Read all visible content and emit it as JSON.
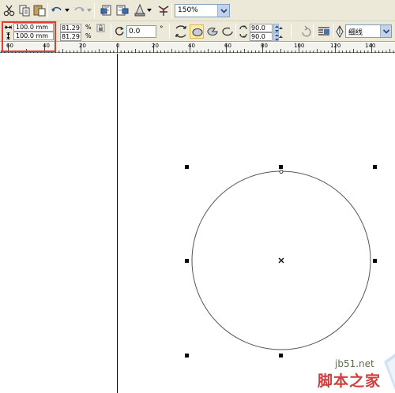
{
  "toolbar": {
    "zoom_value": "150%",
    "icons": [
      "scissors-icon",
      "copy-icon",
      "paste-icon",
      "undo-icon",
      "redo-icon",
      "import-icon",
      "export-icon",
      "application-launcher-icon",
      "welcome-screen-icon"
    ]
  },
  "property_bar": {
    "width_value": "100.0 mm",
    "height_value": "100.0 mm",
    "scale_x_value": "81.29",
    "scale_y_value": "81.29",
    "percent_symbol": "%",
    "rotation_value": "0.0",
    "degree_symbol": "°",
    "start_angle_value": "90.0",
    "end_angle_value": "90.0",
    "outline_width_value": "细线",
    "ellipse_modes": [
      "ellipse",
      "pie",
      "arc"
    ]
  },
  "ruler": {
    "tick_labels": [
      {
        "text": "60"
      },
      {
        "text": "40"
      },
      {
        "text": "20"
      },
      {
        "text": "0"
      },
      {
        "text": "20"
      },
      {
        "text": "40"
      },
      {
        "text": "60"
      },
      {
        "text": "80"
      },
      {
        "text": "100"
      },
      {
        "text": "120"
      },
      {
        "text": "140"
      }
    ]
  },
  "watermark": {
    "site": "jb51.net",
    "name_cn": "脚本之家"
  },
  "colors": {
    "toolbar_bg": "#ece9d8",
    "highlight_border": "#e03c31",
    "circle_stroke": "#555555",
    "handle_fill": "#000000"
  }
}
